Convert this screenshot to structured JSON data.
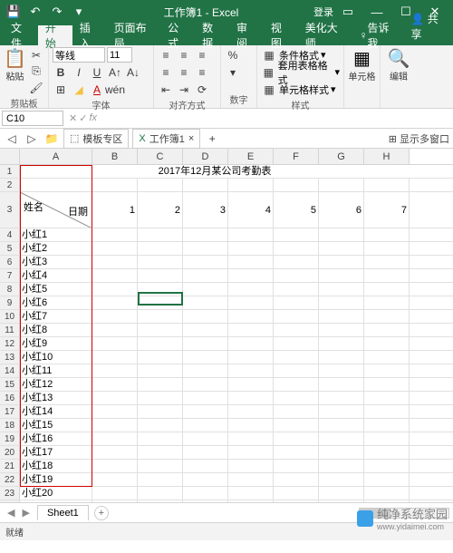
{
  "titlebar": {
    "title": "工作簿1 - Excel",
    "login": "登录"
  },
  "tabs": {
    "file": "文件",
    "home": "开始",
    "insert": "插入",
    "layout": "页面布局",
    "formula": "公式",
    "data": "数据",
    "review": "审阅",
    "view": "视图",
    "beautify": "美化大师",
    "tell": "告诉我",
    "share": "共享"
  },
  "ribbon": {
    "clipboard": {
      "paste": "粘贴",
      "label": "剪贴板"
    },
    "font": {
      "name": "等线",
      "size": "11",
      "label": "字体"
    },
    "align": {
      "label": "对齐方式"
    },
    "number": {
      "label": "数字",
      "percent": "%"
    },
    "styles": {
      "cond": "条件格式",
      "table": "套用表格格式",
      "cell": "单元格样式",
      "label": "样式"
    },
    "cells": {
      "label": "单元格"
    },
    "editing": {
      "label": "编辑"
    }
  },
  "namebox": "C10",
  "tabbar2": {
    "template": "模板专区",
    "workbook": "工作簿1",
    "multiwindow": "显示多窗口"
  },
  "sheet": {
    "title": "2017年12月某公司考勤表",
    "header_date": "日期",
    "header_name": "姓名",
    "cols": [
      "A",
      "B",
      "C",
      "D",
      "E",
      "F",
      "G",
      "H"
    ],
    "day_numbers": [
      1,
      2,
      3,
      4,
      5,
      6,
      7
    ],
    "names": [
      "小红1",
      "小红2",
      "小红3",
      "小红4",
      "小红5",
      "小红6",
      "小红7",
      "小红8",
      "小红9",
      "小红10",
      "小红11",
      "小红12",
      "小红13",
      "小红14",
      "小红15",
      "小红16",
      "小红17",
      "小红18",
      "小红19",
      "小红20"
    ]
  },
  "sheettab": {
    "name": "Sheet1"
  },
  "status": {
    "ready": "就绪"
  },
  "watermark": {
    "text": "纯净系统家园",
    "url": "www.yidaimei.com"
  }
}
